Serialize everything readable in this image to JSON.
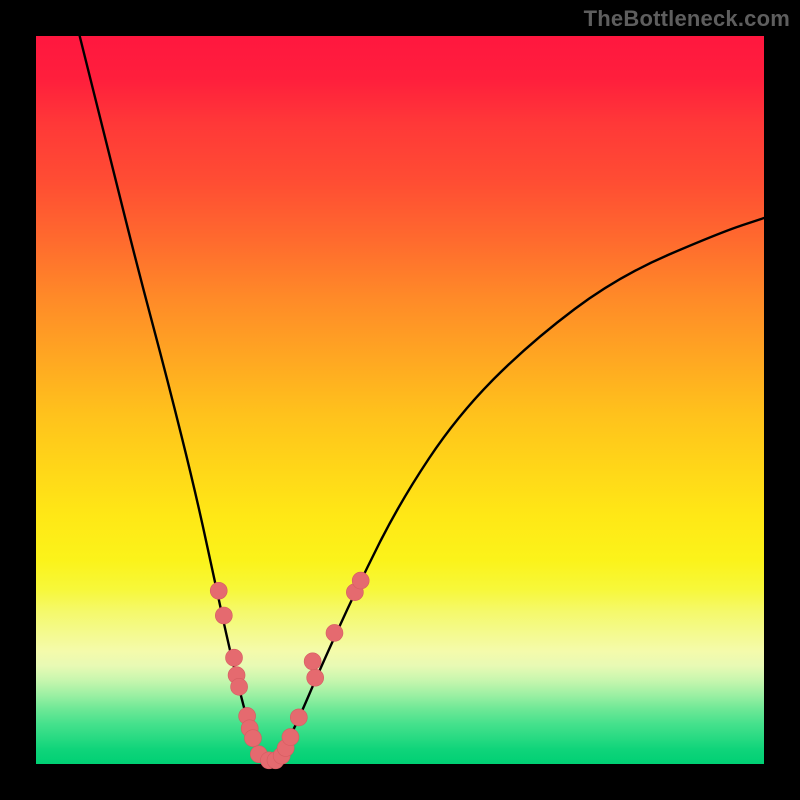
{
  "watermark": "TheBottleneck.com",
  "colors": {
    "background": "#000000",
    "curve": "#000000",
    "dot_fill": "#e56a6f",
    "dot_stroke": "#d55c61"
  },
  "chart_data": {
    "type": "line",
    "title": "",
    "xlabel": "",
    "ylabel": "",
    "xlim": [
      0,
      100
    ],
    "ylim": [
      0,
      100
    ],
    "grid": false,
    "legend": false,
    "series": [
      {
        "name": "bottleneck-curve",
        "x": [
          6,
          10,
          14,
          18,
          22,
          25,
          27,
          29,
          30.5,
          31.5,
          32.5,
          34,
          36,
          39,
          44,
          50,
          58,
          68,
          80,
          94,
          100
        ],
        "y": [
          100,
          84,
          68,
          53,
          37,
          23,
          14,
          6,
          1.5,
          0.5,
          0.5,
          2,
          6,
          13,
          24,
          36,
          48,
          58,
          67,
          73,
          75
        ]
      }
    ],
    "points": [
      {
        "name": "left-upper-1",
        "x": 25.1,
        "y": 23.8
      },
      {
        "name": "left-upper-2",
        "x": 25.8,
        "y": 20.4
      },
      {
        "name": "left-mid-1",
        "x": 27.2,
        "y": 14.6
      },
      {
        "name": "left-mid-2",
        "x": 27.55,
        "y": 12.2
      },
      {
        "name": "left-mid-3",
        "x": 27.9,
        "y": 10.6
      },
      {
        "name": "left-low-1",
        "x": 29.0,
        "y": 6.6
      },
      {
        "name": "left-low-2",
        "x": 29.35,
        "y": 4.9
      },
      {
        "name": "left-low-3",
        "x": 29.8,
        "y": 3.55
      },
      {
        "name": "bottom-1",
        "x": 30.6,
        "y": 1.35
      },
      {
        "name": "bottom-2",
        "x": 32.0,
        "y": 0.5
      },
      {
        "name": "bottom-3",
        "x": 32.9,
        "y": 0.5
      },
      {
        "name": "bottom-4",
        "x": 33.75,
        "y": 1.15
      },
      {
        "name": "right-low-1",
        "x": 34.3,
        "y": 2.2
      },
      {
        "name": "right-low-2",
        "x": 34.95,
        "y": 3.7
      },
      {
        "name": "right-mid-1",
        "x": 36.1,
        "y": 6.4
      },
      {
        "name": "right-mid-2",
        "x": 38.35,
        "y": 11.85
      },
      {
        "name": "right-mid-3",
        "x": 38.0,
        "y": 14.1
      },
      {
        "name": "right-upper-1",
        "x": 41.0,
        "y": 18.0
      },
      {
        "name": "right-upper-2",
        "x": 43.8,
        "y": 23.6
      },
      {
        "name": "right-upper-3",
        "x": 44.6,
        "y": 25.2
      }
    ]
  }
}
